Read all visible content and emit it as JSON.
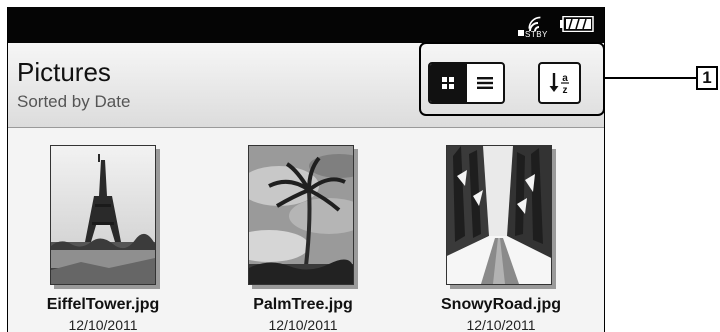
{
  "status_bar": {
    "standby_label": "STBY",
    "icons": [
      "wireless-standby-icon",
      "battery-icon"
    ]
  },
  "header": {
    "title": "Pictures",
    "subtitle": "Sorted by Date"
  },
  "toolbar": {
    "view_modes": [
      {
        "icon": "thumbnail-grid-icon",
        "selected": true
      },
      {
        "icon": "list-view-icon",
        "selected": false
      }
    ],
    "sort_icon": "sort-az-icon",
    "sort_glyph_top": "a",
    "sort_glyph_bottom": "z"
  },
  "files": [
    {
      "name": "EiffelTower.jpg",
      "date": "12/10/2011"
    },
    {
      "name": "PalmTree.jpg",
      "date": "12/10/2011"
    },
    {
      "name": "SnowyRoad.jpg",
      "date": "12/10/2011"
    }
  ],
  "callout": {
    "number": "1"
  }
}
